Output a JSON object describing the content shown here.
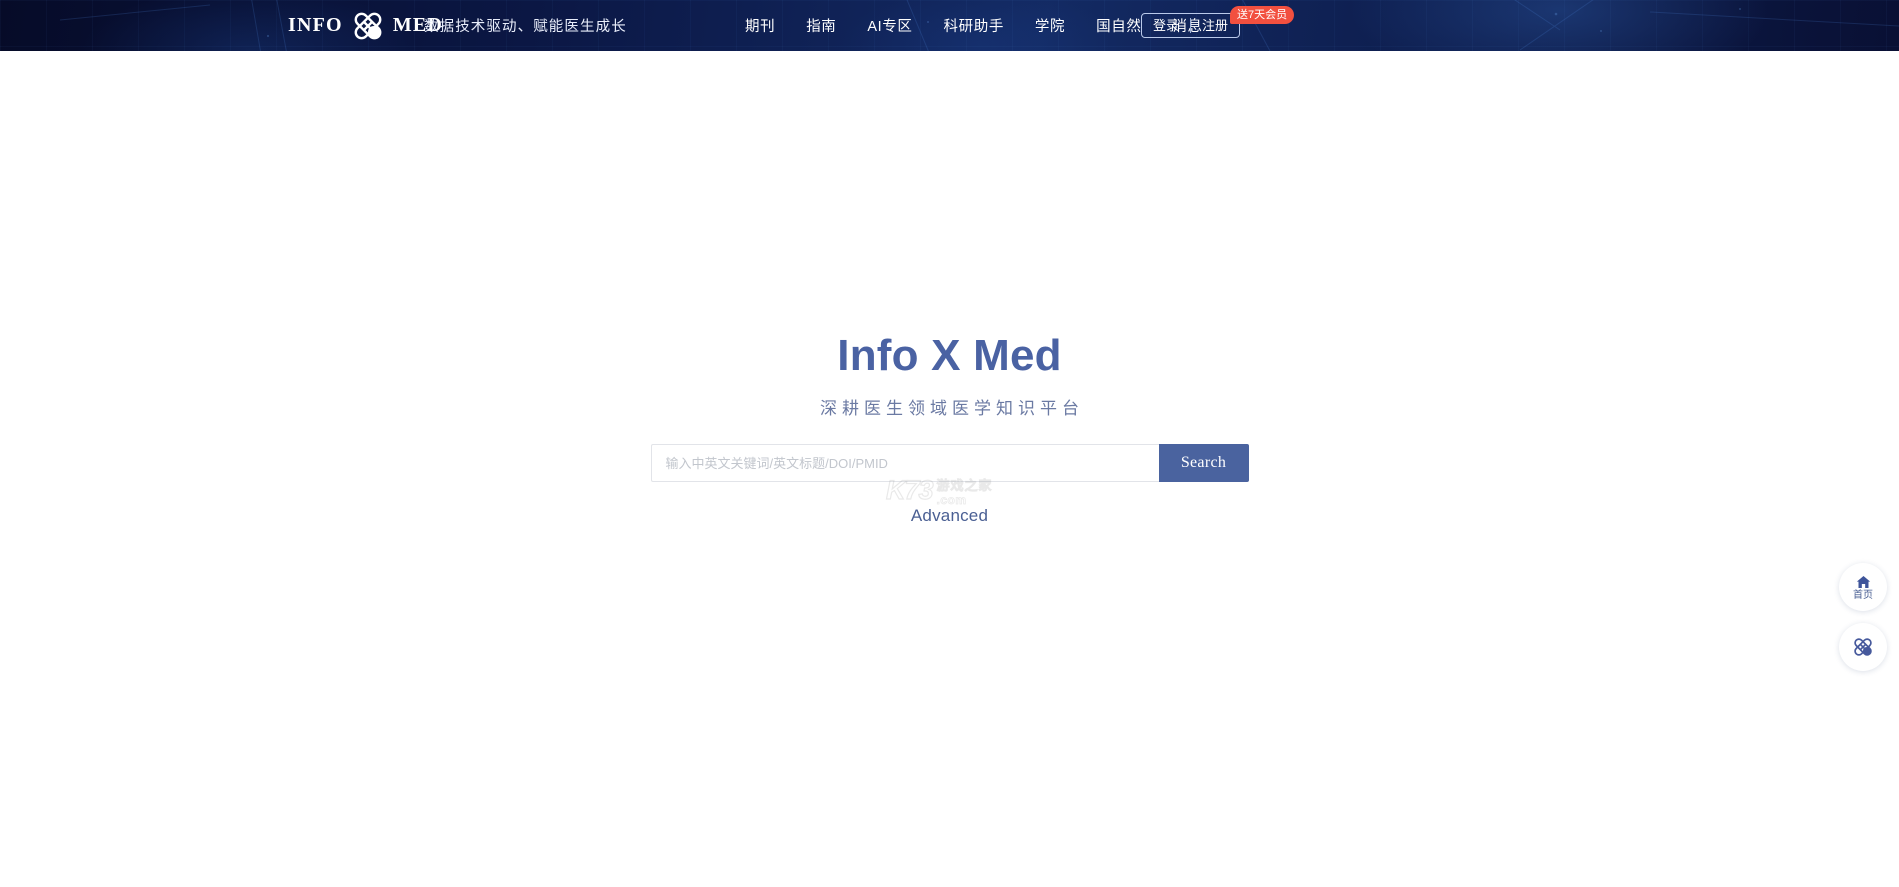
{
  "header": {
    "brand": {
      "info": "INFO",
      "med": "MED",
      "icon": "crossed-bandage-icon"
    },
    "tagline": "数据技术驱动、赋能医生成长",
    "nav_items": [
      {
        "label": "期刊"
      },
      {
        "label": "指南"
      },
      {
        "label": "AI专区"
      },
      {
        "label": "科研助手"
      },
      {
        "label": "学院"
      },
      {
        "label": "国自然"
      },
      {
        "label": "消息"
      }
    ],
    "auth": {
      "login_label": "登录",
      "register_label": "注册",
      "badge_label": "送7天会员",
      "badge_color": "#f2503f"
    },
    "background_color": "#0b1744"
  },
  "hero": {
    "title": "Info X Med",
    "title_color": "#4a62a3",
    "subtitle": "深耕医生领域医学知识平台",
    "subtitle_color": "#6b7aa3"
  },
  "search": {
    "value": "",
    "placeholder": "输入中英文关键词/英文标题/DOI/PMID",
    "button_label": "Search",
    "button_color": "#4a639f",
    "advanced_label": "Advanced"
  },
  "watermark": {
    "logo": "K73",
    "cn_text": "游戏之家",
    "domain": ".com"
  },
  "float_dock": [
    {
      "icon": "home-icon",
      "label": "首页"
    },
    {
      "icon": "crossed-bandage-icon",
      "label": ""
    }
  ]
}
